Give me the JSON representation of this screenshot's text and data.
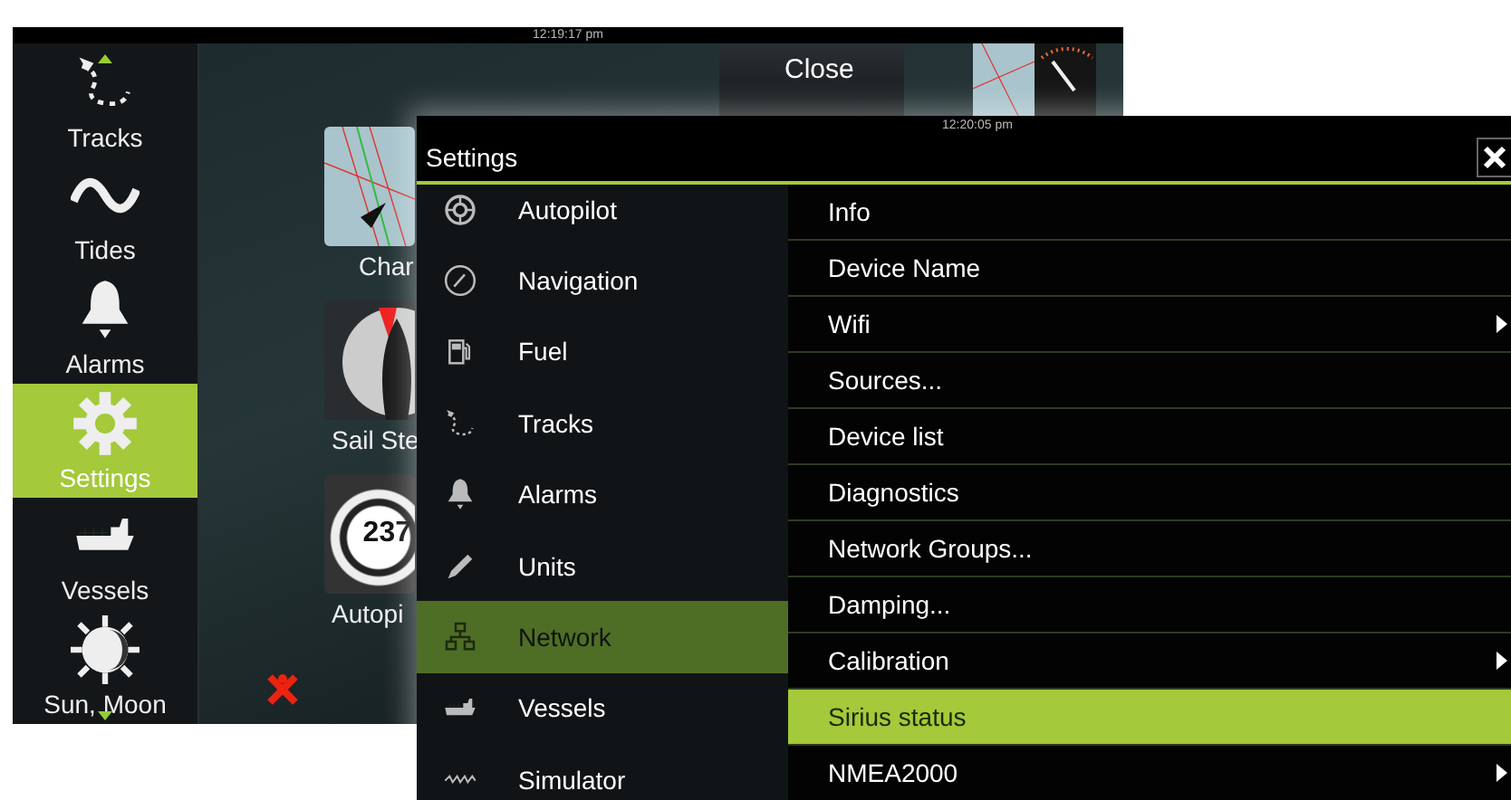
{
  "back_screen": {
    "clock": "12:19:17 pm",
    "sidebar": [
      {
        "label": "Tracks",
        "kind": "tracks",
        "selected": false
      },
      {
        "label": "Tides",
        "kind": "tides",
        "selected": false
      },
      {
        "label": "Alarms",
        "kind": "alarms",
        "selected": false
      },
      {
        "label": "Settings",
        "kind": "settings",
        "selected": true
      },
      {
        "label": "Vessels",
        "kind": "vessels",
        "selected": false
      },
      {
        "label": "Sun, Moon",
        "kind": "sunmoon",
        "selected": false
      }
    ],
    "close_button": "Close",
    "tiles": [
      {
        "label": "Char",
        "kind": "chart"
      },
      {
        "label": "Sail Ste",
        "kind": "sail"
      },
      {
        "label": "Autopi",
        "kind": "autopilot",
        "reading": "237"
      }
    ]
  },
  "settings_window": {
    "clock": "12:20:05 pm",
    "title": "Settings",
    "categories": [
      {
        "label": "Autopilot",
        "kind": "autopilot",
        "selected": false
      },
      {
        "label": "Navigation",
        "kind": "navigation",
        "selected": false
      },
      {
        "label": "Fuel",
        "kind": "fuel",
        "selected": false
      },
      {
        "label": "Tracks",
        "kind": "tracks",
        "selected": false
      },
      {
        "label": "Alarms",
        "kind": "alarms",
        "selected": false
      },
      {
        "label": "Units",
        "kind": "units",
        "selected": false
      },
      {
        "label": "Network",
        "kind": "network",
        "selected": true
      },
      {
        "label": "Vessels",
        "kind": "vessels",
        "selected": false
      },
      {
        "label": "Simulator",
        "kind": "simulator",
        "selected": false
      }
    ],
    "options": [
      {
        "label": "Info",
        "submenu": false,
        "selected": false
      },
      {
        "label": "Device Name",
        "submenu": false,
        "selected": false
      },
      {
        "label": "Wifi",
        "submenu": true,
        "selected": false
      },
      {
        "label": "Sources...",
        "submenu": false,
        "selected": false
      },
      {
        "label": "Device list",
        "submenu": false,
        "selected": false
      },
      {
        "label": "Diagnostics",
        "submenu": false,
        "selected": false
      },
      {
        "label": "Network Groups...",
        "submenu": false,
        "selected": false
      },
      {
        "label": "Damping...",
        "submenu": false,
        "selected": false
      },
      {
        "label": "Calibration",
        "submenu": true,
        "selected": false
      },
      {
        "label": "Sirius status",
        "submenu": false,
        "selected": true
      },
      {
        "label": "NMEA2000",
        "submenu": true,
        "selected": false
      }
    ]
  }
}
